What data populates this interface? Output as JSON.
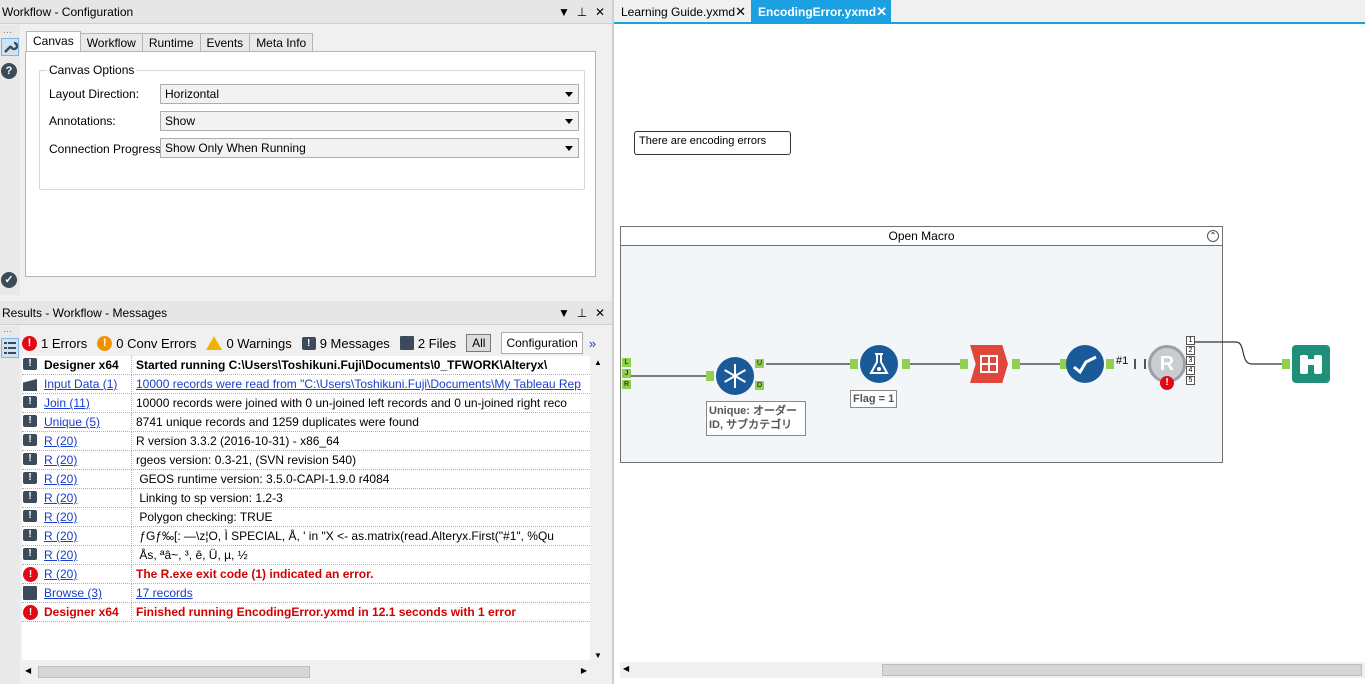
{
  "config_panel": {
    "title": "Workflow - Configuration",
    "title_buttons": [
      "▼",
      "⊥",
      "✕"
    ],
    "tabs": [
      "Canvas",
      "Workflow",
      "Runtime",
      "Events",
      "Meta Info"
    ],
    "group_title": "Canvas Options",
    "fields": [
      {
        "label": "Layout Direction:",
        "value": "Horizontal"
      },
      {
        "label": "Annotations:",
        "value": "Show"
      },
      {
        "label": "Connection Progress:",
        "value": "Show Only When Running"
      }
    ],
    "side_icons": [
      "wrench-icon",
      "help-icon",
      "check-icon"
    ]
  },
  "results_panel": {
    "title": "Results - Workflow - Messages",
    "title_buttons": [
      "▼",
      "⊥",
      "✕"
    ],
    "toolbar": {
      "errors": "1 Errors",
      "conv_errors": "0 Conv Errors",
      "warnings": "0 Warnings",
      "messages": "9 Messages",
      "files": "2 Files",
      "all": "All",
      "configuration": "Configuration",
      "more": "»"
    },
    "rows": [
      {
        "type": "message",
        "source": "Designer x64",
        "text": "Started running C:\\Users\\Toshikuni.Fuji\\Documents\\0_TFWORK\\Alteryx\\",
        "bold": true,
        "link": false
      },
      {
        "type": "input",
        "source": "Input Data (1)",
        "text": "10000 records were read from \"C:\\Users\\Toshikuni.Fuji\\Documents\\My Tableau Rep",
        "bold": false,
        "link": true
      },
      {
        "type": "message",
        "source": "Join (11)",
        "text": "10000 records were joined with 0 un-joined left records and 0 un-joined right reco",
        "bold": false,
        "link": false
      },
      {
        "type": "message",
        "source": "Unique (5)",
        "text": "8741 unique records and 1259 duplicates were found",
        "bold": false,
        "link": false
      },
      {
        "type": "message",
        "source": "R (20)",
        "text": "R version 3.3.2 (2016-10-31) - x86_64",
        "bold": false,
        "link": false
      },
      {
        "type": "message",
        "source": "R (20)",
        "text": "rgeos version: 0.3-21, (SVN revision 540)",
        "bold": false,
        "link": false
      },
      {
        "type": "message",
        "source": "R (20)",
        "text": " GEOS runtime version: 3.5.0-CAPI-1.9.0 r4084",
        "bold": false,
        "link": false
      },
      {
        "type": "message",
        "source": "R (20)",
        "text": " Linking to sp version: 1.2-3",
        "bold": false,
        "link": false
      },
      {
        "type": "message",
        "source": "R (20)",
        "text": " Polygon checking: TRUE",
        "bold": false,
        "link": false
      },
      {
        "type": "message",
        "source": "R (20)",
        "text": " ƒGƒ‰[: —\\z¦O, Ì SPECIAL, Å, ' in \"X <- as.matrix(read.Alteryx.First(\"#1\", %Qu",
        "bold": false,
        "link": false
      },
      {
        "type": "message",
        "source": "R (20)",
        "text": " Ås, ªâ~, ³, ê, Ü, µ, ½",
        "bold": false,
        "link": false
      },
      {
        "type": "error",
        "source": "R (20)",
        "text": "The R.exe exit code (1) indicated an error.",
        "bold": false,
        "link": false
      },
      {
        "type": "file",
        "source": "Browse (3)",
        "text": "17 records",
        "bold": false,
        "link": true
      },
      {
        "type": "error",
        "source": "Designer x64",
        "text": "Finished running EncodingError.yxmd in 12.1 seconds with 1 error",
        "bold": false,
        "link": false
      }
    ]
  },
  "canvas": {
    "tabs": [
      {
        "label": "Learning Guide.yxmd",
        "active": false
      },
      {
        "label": "EncodingError.yxmd",
        "active": true
      }
    ],
    "comment": "There are encoding errors",
    "container_title": "Open Macro",
    "unique_label": "Unique: オーダーID, サブカテゴリ",
    "unique_label_line1": "Unique: オーダー",
    "unique_label_line2": "ID, サブカテゴリ",
    "formula_label": "Flag = 1",
    "r_input_label": "#1",
    "r_outputs": [
      "1",
      "2",
      "3",
      "4",
      "5"
    ],
    "join_ports": [
      "L",
      "J",
      "R"
    ],
    "unique_ports": [
      "U",
      "D"
    ],
    "colors": {
      "accent": "#1ba1e2",
      "tool_blue": "#1a5a99",
      "tool_red": "#e0463c",
      "tool_green": "#1f8f7a",
      "error": "#e30613"
    }
  }
}
